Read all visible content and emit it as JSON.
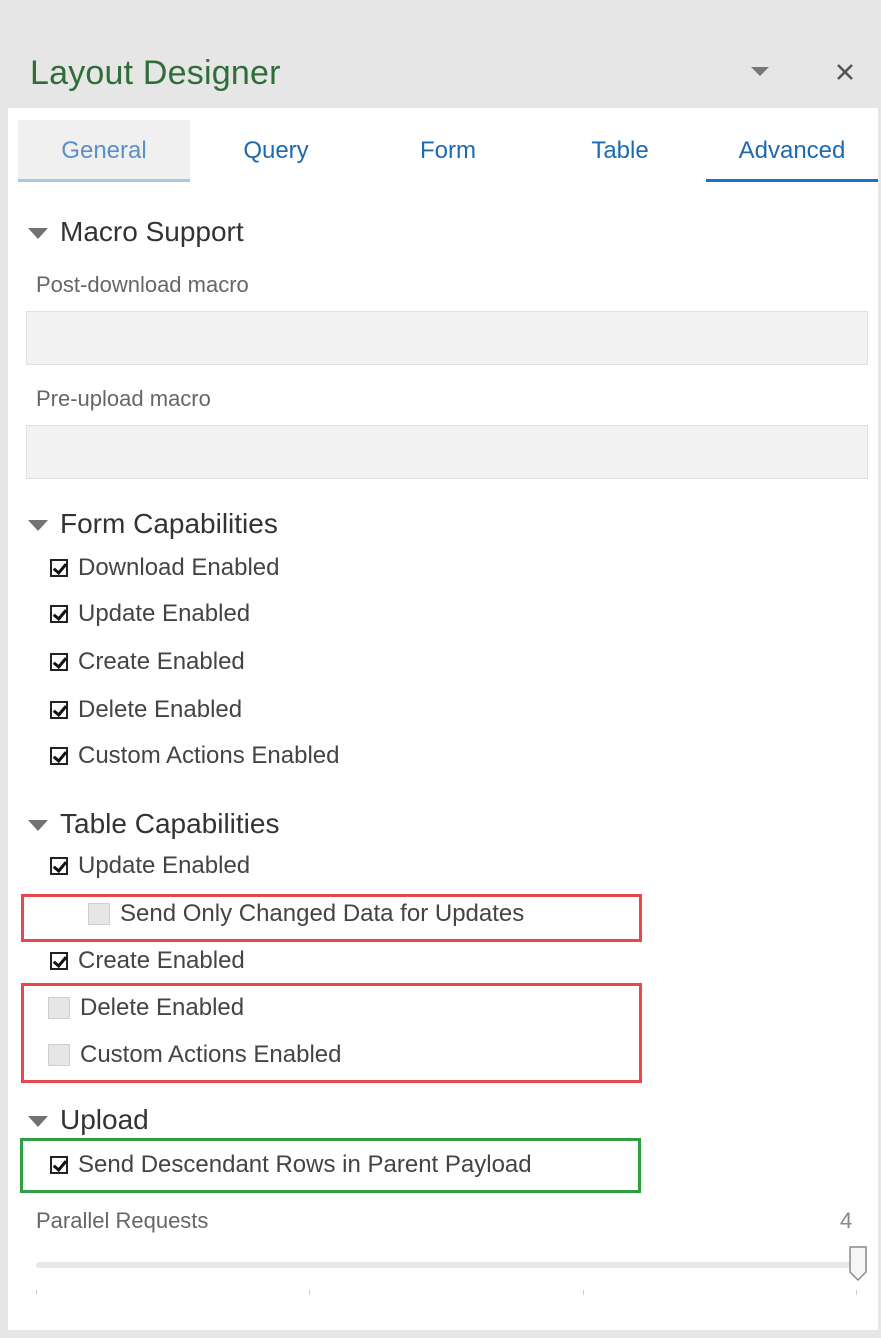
{
  "header": {
    "title": "Layout Designer",
    "dropdown_icon": "chevron-down-icon",
    "close_icon": "close-icon",
    "title_color": "#2f6e37"
  },
  "tabs": [
    {
      "label": "General",
      "selected": true
    },
    {
      "label": "Query",
      "selected": false
    },
    {
      "label": "Form",
      "selected": false
    },
    {
      "label": "Table",
      "selected": false
    },
    {
      "label": "Advanced",
      "selected": false
    }
  ],
  "macro_support": {
    "heading": "Macro Support",
    "post_download_label": "Post-download macro",
    "post_download_value": "",
    "pre_upload_label": "Pre-upload macro",
    "pre_upload_value": ""
  },
  "form_capabilities": {
    "heading": "Form Capabilities",
    "items": [
      {
        "label": "Download Enabled",
        "checked": true
      },
      {
        "label": "Update Enabled",
        "checked": true
      },
      {
        "label": "Create Enabled",
        "checked": true
      },
      {
        "label": "Delete Enabled",
        "checked": true
      },
      {
        "label": "Custom Actions Enabled",
        "checked": true
      }
    ]
  },
  "table_capabilities": {
    "heading": "Table Capabilities",
    "items": [
      {
        "label": "Update Enabled",
        "checked": true
      },
      {
        "label": "Send Only Changed Data for Updates",
        "checked": false
      },
      {
        "label": "Create Enabled",
        "checked": true
      },
      {
        "label": "Delete Enabled",
        "checked": false
      },
      {
        "label": "Custom Actions Enabled",
        "checked": false
      }
    ]
  },
  "upload": {
    "heading": "Upload",
    "items": [
      {
        "label": "Send Descendant Rows in Parent Payload",
        "checked": true
      }
    ],
    "parallel_requests_label": "Parallel Requests",
    "parallel_requests_value": "4",
    "slider_fraction": 1.0
  },
  "highlight_colors": {
    "red": "#e8474b",
    "green": "#2ea043"
  }
}
